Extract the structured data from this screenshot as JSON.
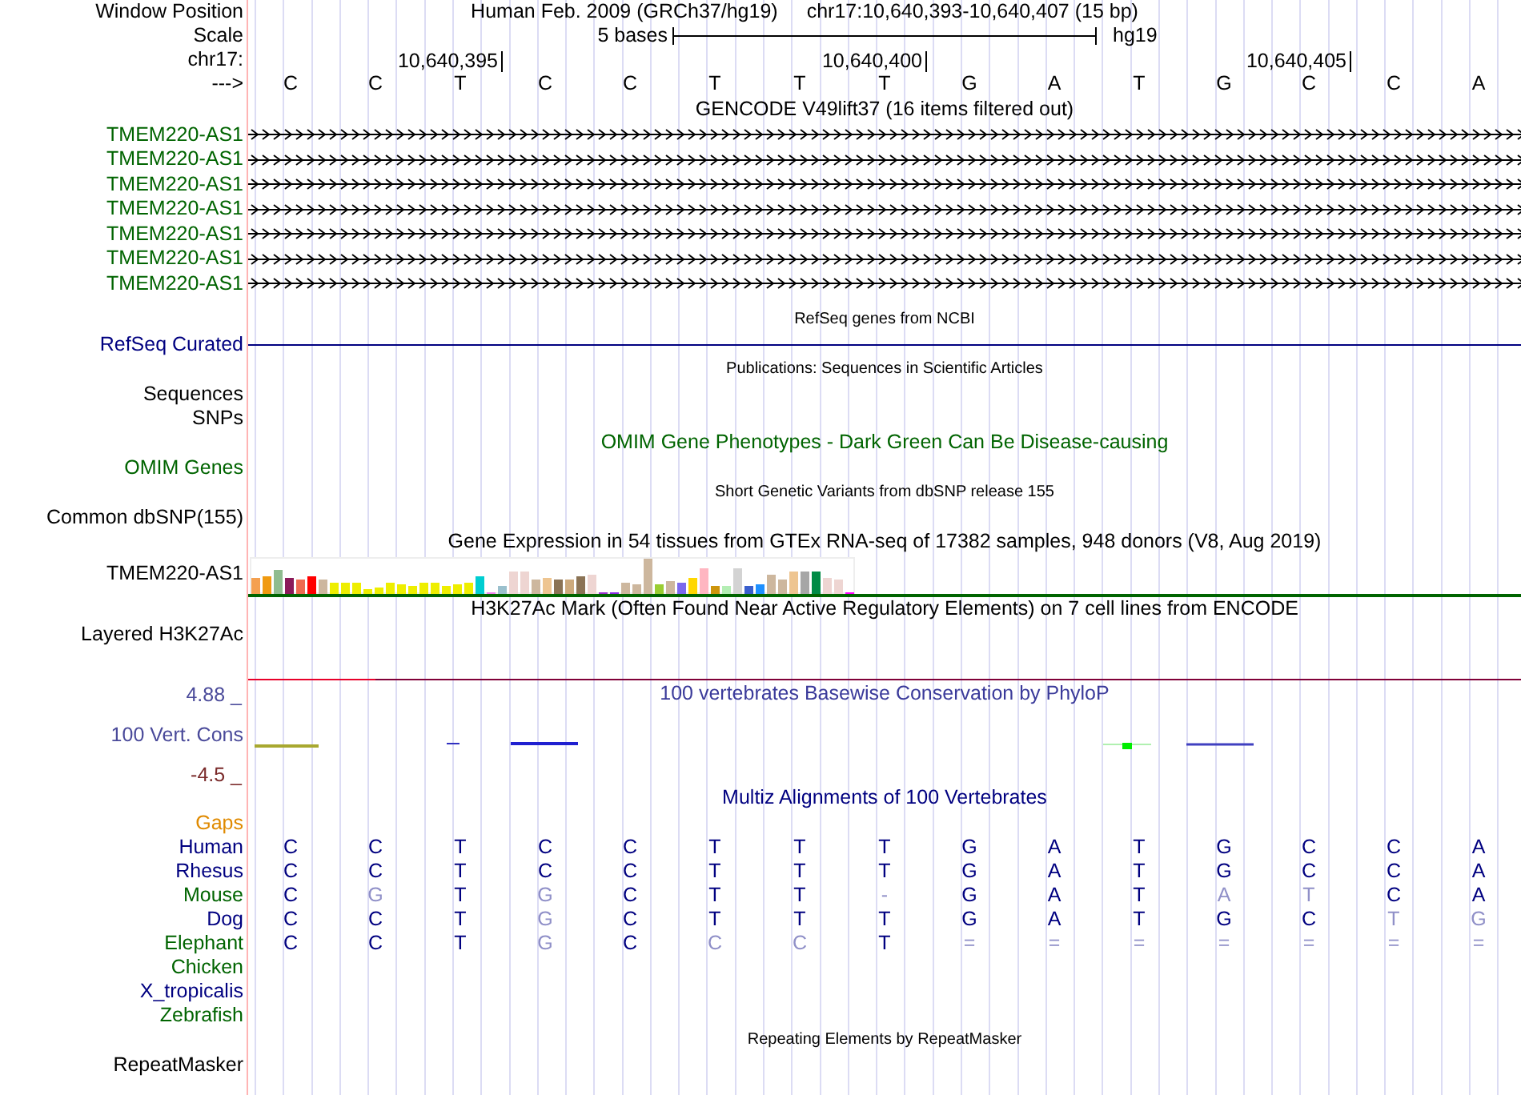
{
  "header": {
    "window_label": "Window Position",
    "assembly": "Human Feb. 2009 (GRCh37/hg19)",
    "range": "chr17:10,640,393-10,640,407 (15 bp)",
    "scale_label": "Scale",
    "scale_text": "5 bases",
    "scale_assembly": "hg19",
    "chrom_label": "chr17:",
    "positions": [
      "10,640,395",
      "10,640,400",
      "10,640,405"
    ],
    "strand_label": "--->",
    "bases": [
      "C",
      "C",
      "T",
      "C",
      "C",
      "T",
      "T",
      "T",
      "G",
      "A",
      "T",
      "G",
      "C",
      "C",
      "A"
    ]
  },
  "tracks": [
    {
      "kind": "gene",
      "title": "GENCODE V49lift37 (16 items filtered out)",
      "labels": [
        "TMEM220-AS1",
        "TMEM220-AS1",
        "TMEM220-AS1",
        "TMEM220-AS1",
        "TMEM220-AS1",
        "TMEM220-AS1",
        "TMEM220-AS1"
      ]
    },
    {
      "kind": "refseq",
      "title": "RefSeq genes from NCBI",
      "labels": [
        "RefSeq Curated"
      ]
    },
    {
      "kind": "blank",
      "title": "Publications: Sequences in Scientific Articles",
      "labels": [
        "Sequences",
        "SNPs"
      ]
    },
    {
      "kind": "omim",
      "title": "OMIM Gene Phenotypes - Dark Green Can Be Disease-causing",
      "labels": [
        "OMIM Genes"
      ]
    },
    {
      "kind": "blank",
      "title": "Short Genetic Variants from dbSNP release 155",
      "labels": [
        "Common dbSNP(155)"
      ]
    },
    {
      "kind": "expression",
      "title": "Gene Expression in 54 tissues from GTEx RNA-seq of 17382 samples, 948 donors (V8, Aug 2019)",
      "labels": [
        "TMEM220-AS1"
      ]
    },
    {
      "kind": "layered",
      "title": "H3K27Ac Mark (Often Found Near Active Regulatory Elements) on 7 cell lines from ENCODE",
      "labels": [
        "Layered H3K27Ac"
      ]
    },
    {
      "kind": "conservation",
      "title": "100 vertebrates Basewise Conservation by PhyloP",
      "labels": [
        "100 Vert. Cons"
      ],
      "max": "4.88 _",
      "min": "-4.5 _"
    },
    {
      "kind": "alignment",
      "title": "Multiz Alignments of 100 Vertebrates",
      "gaps_label": "Gaps",
      "species": [
        {
          "name": "Human",
          "color": "#000080",
          "bases": [
            {
              "b": "C",
              "match": true
            },
            {
              "b": "C",
              "match": true
            },
            {
              "b": "T",
              "match": true
            },
            {
              "b": "C",
              "match": true
            },
            {
              "b": "C",
              "match": true
            },
            {
              "b": "T",
              "match": true
            },
            {
              "b": "T",
              "match": true
            },
            {
              "b": "T",
              "match": true
            },
            {
              "b": "G",
              "match": true
            },
            {
              "b": "A",
              "match": true
            },
            {
              "b": "T",
              "match": true
            },
            {
              "b": "G",
              "match": true
            },
            {
              "b": "C",
              "match": true
            },
            {
              "b": "C",
              "match": true
            },
            {
              "b": "A",
              "match": true
            }
          ]
        },
        {
          "name": "Rhesus",
          "color": "#000080",
          "bases": [
            {
              "b": "C",
              "match": true
            },
            {
              "b": "C",
              "match": true
            },
            {
              "b": "T",
              "match": true
            },
            {
              "b": "C",
              "match": true
            },
            {
              "b": "C",
              "match": true
            },
            {
              "b": "T",
              "match": true
            },
            {
              "b": "T",
              "match": true
            },
            {
              "b": "T",
              "match": true
            },
            {
              "b": "G",
              "match": true
            },
            {
              "b": "A",
              "match": true
            },
            {
              "b": "T",
              "match": true
            },
            {
              "b": "G",
              "match": true
            },
            {
              "b": "C",
              "match": true
            },
            {
              "b": "C",
              "match": true
            },
            {
              "b": "A",
              "match": true
            }
          ]
        },
        {
          "name": "Mouse",
          "color": "#006400",
          "bases": [
            {
              "b": "C",
              "match": true
            },
            {
              "b": "G",
              "match": false
            },
            {
              "b": "T",
              "match": true
            },
            {
              "b": "G",
              "match": false
            },
            {
              "b": "C",
              "match": true
            },
            {
              "b": "T",
              "match": true
            },
            {
              "b": "T",
              "match": true
            },
            {
              "b": "-",
              "match": false
            },
            {
              "b": "G",
              "match": true
            },
            {
              "b": "A",
              "match": true
            },
            {
              "b": "T",
              "match": true
            },
            {
              "b": "A",
              "match": false
            },
            {
              "b": "T",
              "match": false
            },
            {
              "b": "C",
              "match": true
            },
            {
              "b": "A",
              "match": true
            }
          ]
        },
        {
          "name": "Dog",
          "color": "#000080",
          "bases": [
            {
              "b": "C",
              "match": true
            },
            {
              "b": "C",
              "match": true
            },
            {
              "b": "T",
              "match": true
            },
            {
              "b": "G",
              "match": false
            },
            {
              "b": "C",
              "match": true
            },
            {
              "b": "T",
              "match": true
            },
            {
              "b": "T",
              "match": true
            },
            {
              "b": "T",
              "match": true
            },
            {
              "b": "G",
              "match": true
            },
            {
              "b": "A",
              "match": true
            },
            {
              "b": "T",
              "match": true
            },
            {
              "b": "G",
              "match": true
            },
            {
              "b": "C",
              "match": true
            },
            {
              "b": "T",
              "match": false
            },
            {
              "b": "G",
              "match": false
            }
          ]
        },
        {
          "name": "Elephant",
          "color": "#006400",
          "bases": [
            {
              "b": "C",
              "match": true
            },
            {
              "b": "C",
              "match": true
            },
            {
              "b": "T",
              "match": true
            },
            {
              "b": "G",
              "match": false
            },
            {
              "b": "C",
              "match": true
            },
            {
              "b": "C",
              "match": false
            },
            {
              "b": "C",
              "match": false
            },
            {
              "b": "T",
              "match": true
            },
            {
              "b": "=",
              "match": false
            },
            {
              "b": "=",
              "match": false
            },
            {
              "b": "=",
              "match": false
            },
            {
              "b": "=",
              "match": false
            },
            {
              "b": "=",
              "match": false
            },
            {
              "b": "=",
              "match": false
            },
            {
              "b": "=",
              "match": false
            }
          ]
        },
        {
          "name": "Chicken",
          "color": "#006400"
        },
        {
          "name": "X_tropicalis",
          "color": "#000080"
        },
        {
          "name": "Zebrafish",
          "color": "#006400"
        }
      ]
    },
    {
      "kind": "blank",
      "title": "Repeating Elements by RepeatMasker",
      "labels": [
        "RepeatMasker"
      ]
    }
  ]
}
